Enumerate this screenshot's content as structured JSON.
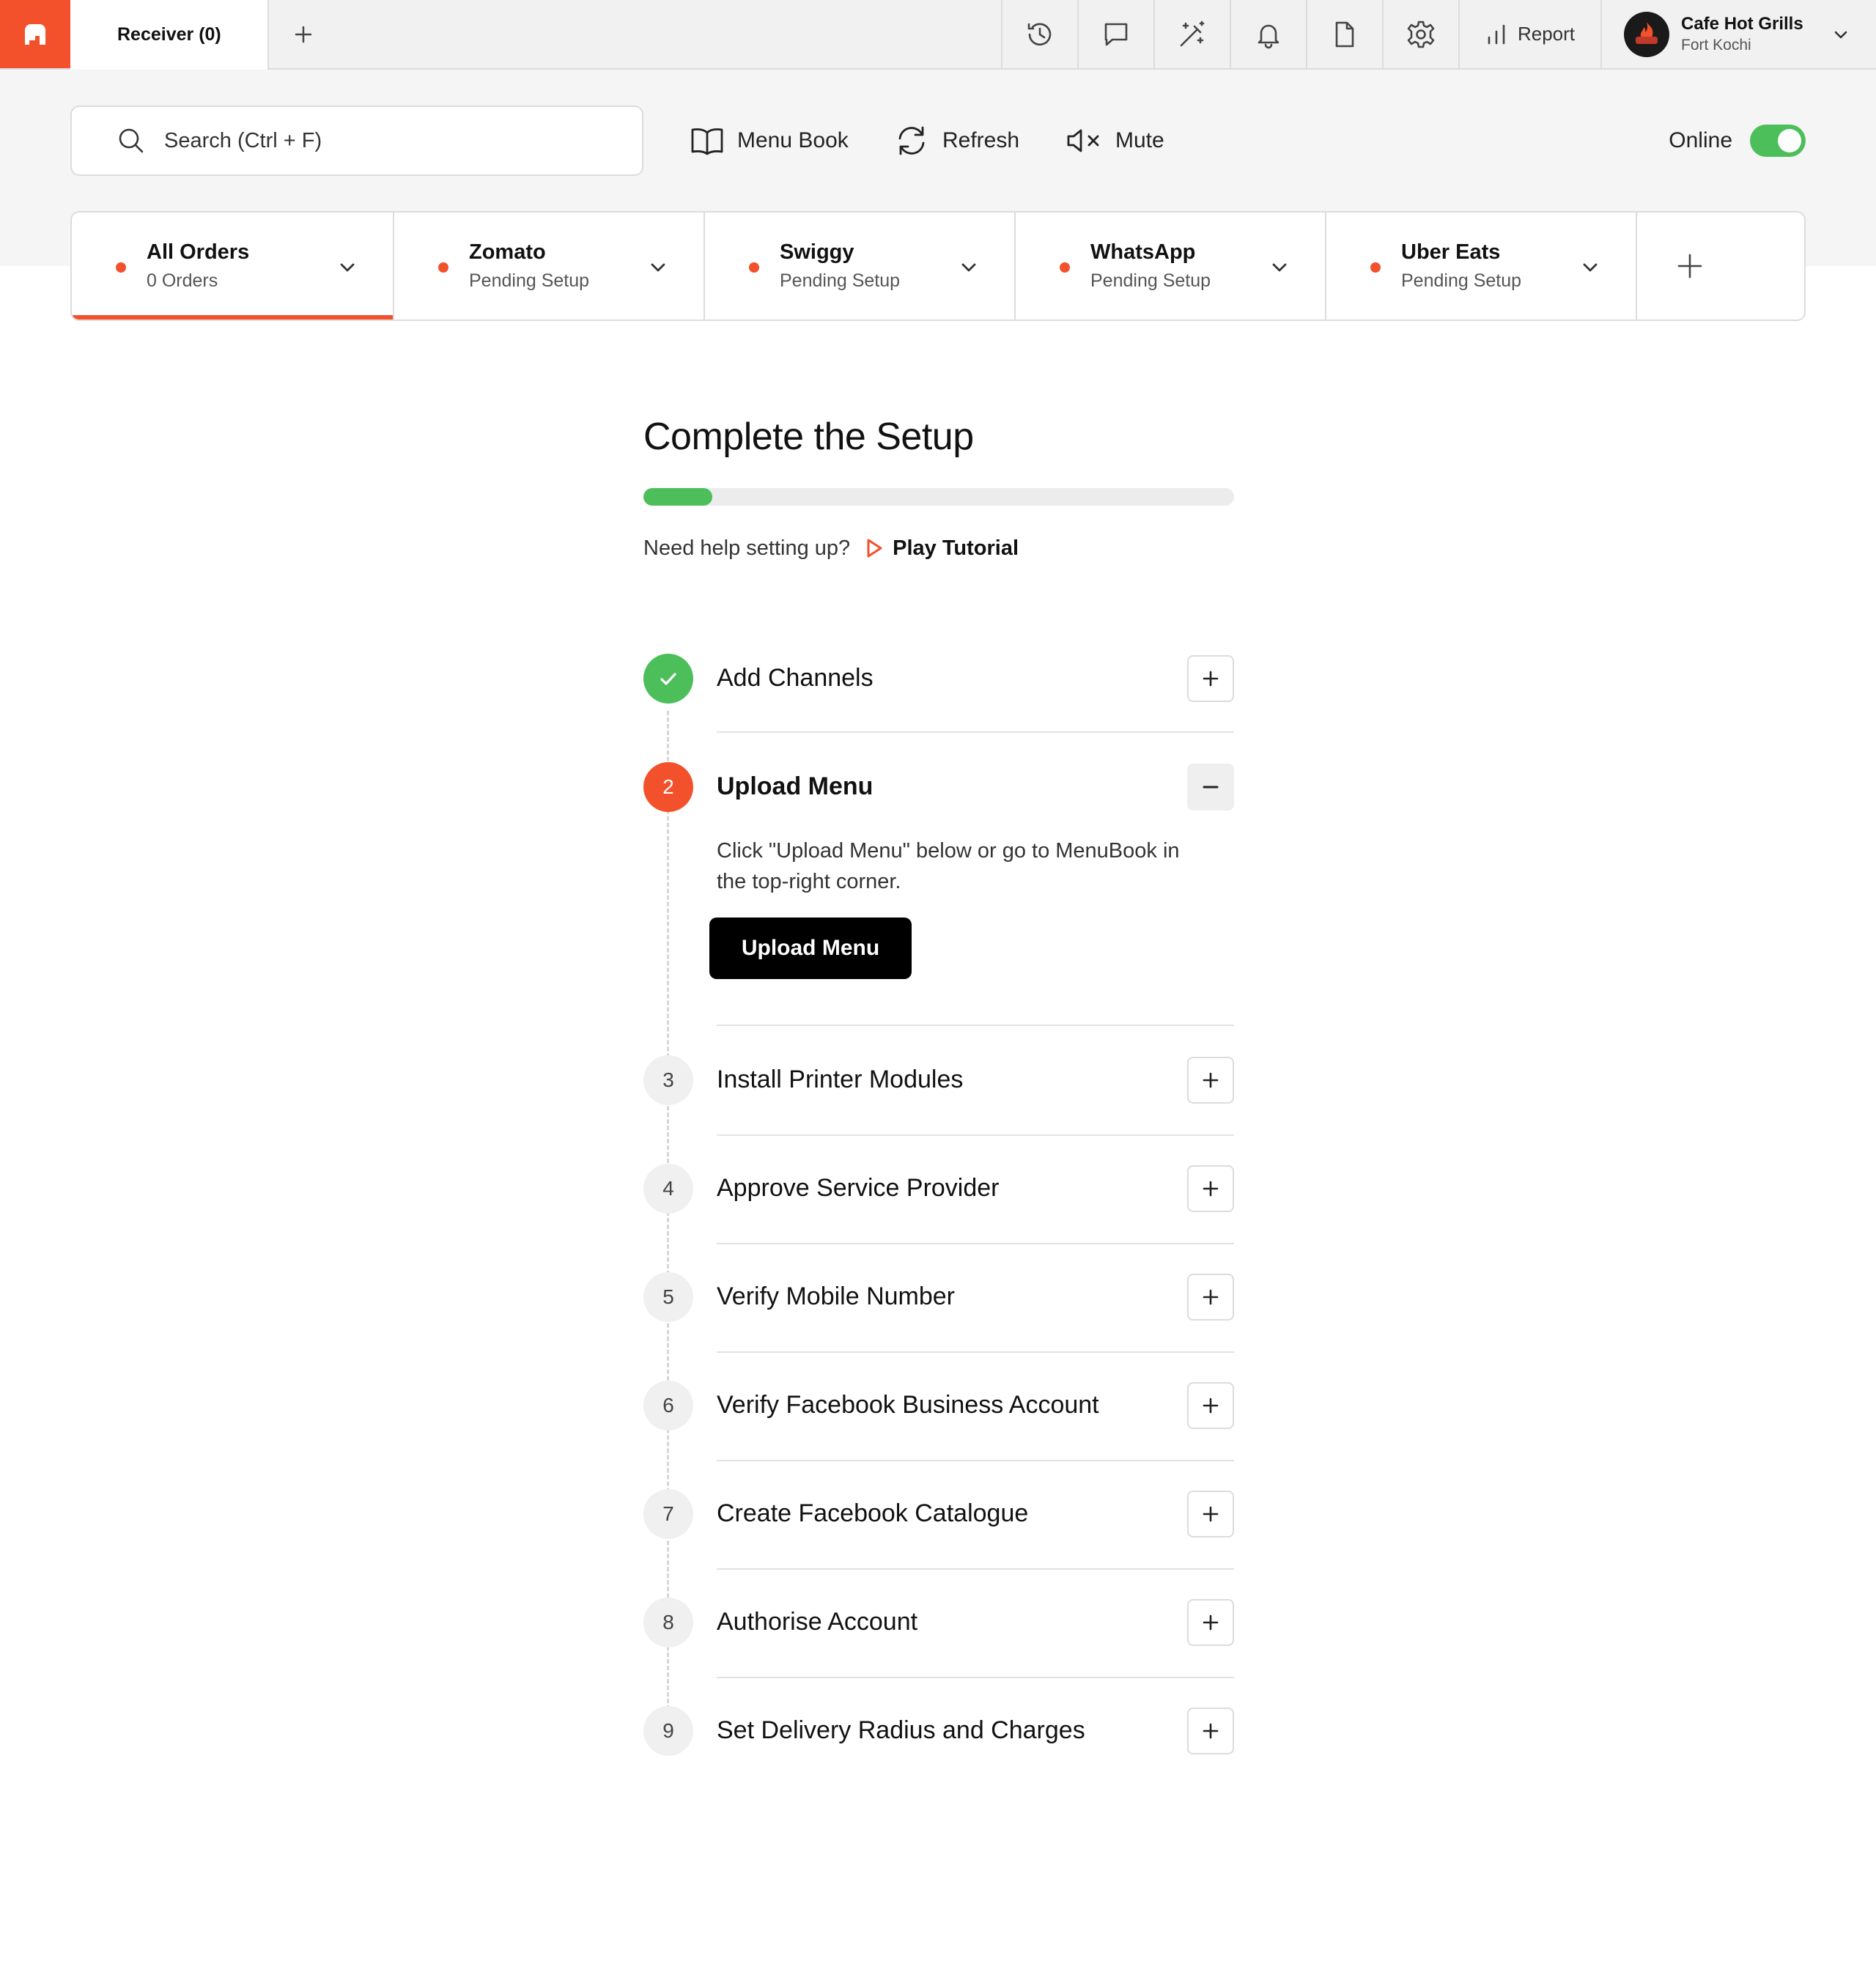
{
  "topbar": {
    "tab_label": "Receiver (0)",
    "report_label": "Report",
    "account_name": "Cafe Hot Grills",
    "account_location": "Fort Kochi",
    "icons": [
      "history-icon",
      "chat-icon",
      "magic-wand-icon",
      "bell-icon",
      "file-icon",
      "gear-icon"
    ]
  },
  "toolbar": {
    "search_placeholder": "Search (Ctrl + F)",
    "menu_book_label": "Menu Book",
    "refresh_label": "Refresh",
    "mute_label": "Mute",
    "online_label": "Online",
    "online": true
  },
  "channels": [
    {
      "name": "All Orders",
      "sub": "0 Orders",
      "active": true
    },
    {
      "name": "Zomato",
      "sub": "Pending Setup"
    },
    {
      "name": "Swiggy",
      "sub": "Pending Setup"
    },
    {
      "name": "WhatsApp",
      "sub": "Pending Setup"
    },
    {
      "name": "Uber Eats",
      "sub": "Pending Setup"
    }
  ],
  "setup": {
    "title": "Complete the Setup",
    "progress_fraction": 0.117,
    "help_text": "Need help setting up?",
    "tutorial_label": "Play Tutorial",
    "steps": [
      {
        "number": "1",
        "label": "Add Channels",
        "status": "done"
      },
      {
        "number": "2",
        "label": "Upload Menu",
        "status": "current",
        "description": "Click \"Upload Menu\" below or go to MenuBook in the top-right corner.",
        "button_label": "Upload Menu"
      },
      {
        "number": "3",
        "label": "Install Printer Modules",
        "status": "pending"
      },
      {
        "number": "4",
        "label": "Approve Service Provider",
        "status": "pending"
      },
      {
        "number": "5",
        "label": "Verify Mobile Number",
        "status": "pending"
      },
      {
        "number": "6",
        "label": "Verify Facebook Business Account",
        "status": "pending"
      },
      {
        "number": "7",
        "label": "Create Facebook Catalogue",
        "status": "pending"
      },
      {
        "number": "8",
        "label": "Authorise Account",
        "status": "pending"
      },
      {
        "number": "9",
        "label": "Set Delivery Radius and Charges",
        "status": "pending"
      }
    ]
  },
  "colors": {
    "brand": "#f2512b",
    "success": "#4cbf5a",
    "border": "#dcdcdc"
  }
}
